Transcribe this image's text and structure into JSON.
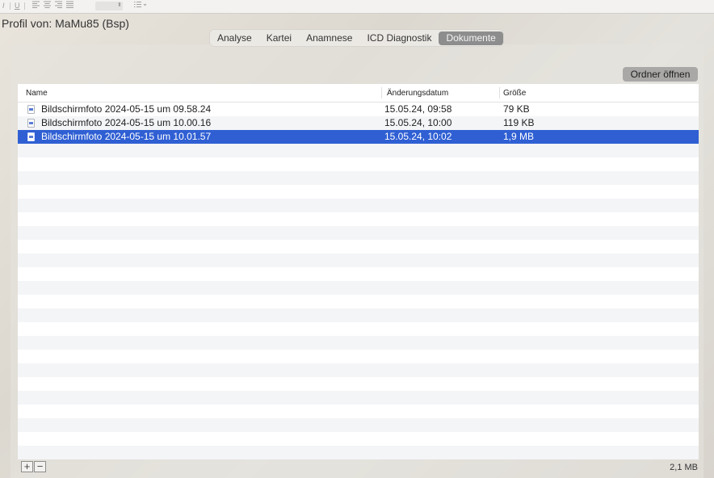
{
  "toolbar": {
    "italic_label": "I",
    "underline_label": "U",
    "align_left_icon": "align-left-icon",
    "align_center_icon": "align-center-icon",
    "align_right_icon": "align-right-icon",
    "justify_icon": "justify-icon",
    "stepper_icon": "stepper-icon",
    "list_icon": "list-icon"
  },
  "profile": {
    "title": "Profil von: MaMu85 (Bsp)"
  },
  "tabs": [
    {
      "label": "Analyse",
      "selected": false
    },
    {
      "label": "Kartei",
      "selected": false
    },
    {
      "label": "Anamnese",
      "selected": false
    },
    {
      "label": "ICD Diagnostik",
      "selected": false
    },
    {
      "label": "Dokumente",
      "selected": true
    }
  ],
  "open_folder_label": "Ordner öffnen",
  "table": {
    "columns": {
      "name": "Name",
      "modified": "Änderungsdatum",
      "size": "Größe"
    },
    "rows": [
      {
        "name": "Bildschirmfoto 2024-05-15 um 09.58.24",
        "modified": "15.05.24, 09:58",
        "size": "79 KB",
        "selected": false
      },
      {
        "name": "Bildschirmfoto 2024-05-15 um 10.00.16",
        "modified": "15.05.24, 10:00",
        "size": "119 KB",
        "selected": false
      },
      {
        "name": "Bildschirmfoto 2024-05-15 um 10.01.57",
        "modified": "15.05.24, 10:02",
        "size": "1,9 MB",
        "selected": true
      }
    ]
  },
  "footer": {
    "add_label": "+",
    "remove_label": "−",
    "total_size": "2,1 MB"
  },
  "colors": {
    "selection": "#2f5fd3",
    "selected_tab": "#8d8d8d",
    "stripe": "#f4f5f7"
  }
}
